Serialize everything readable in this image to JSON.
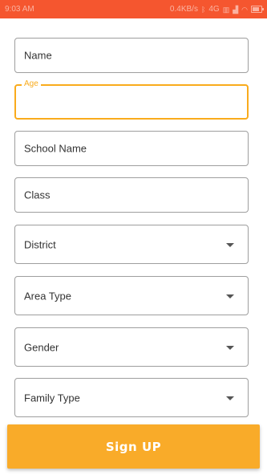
{
  "status_bar": {
    "time": "9:03 AM",
    "network_speed": "0.4KB/s",
    "network_type": "4G",
    "battery_fraction": 0.8,
    "icons": [
      "bluetooth-icon",
      "sim-icon",
      "signal-icon",
      "wifi-icon",
      "battery-icon"
    ]
  },
  "form": {
    "fields": [
      {
        "label": "Name",
        "type": "text"
      },
      {
        "label": "Age",
        "type": "text",
        "state": "focused"
      },
      {
        "label": "School Name",
        "type": "text"
      },
      {
        "label": "Class",
        "type": "text"
      }
    ],
    "dropdowns": [
      {
        "label": "District"
      },
      {
        "label": "Area Type"
      },
      {
        "label": "Gender"
      },
      {
        "label": "Family Type"
      }
    ],
    "submit_label": "Sign UP"
  },
  "colors": {
    "status_bar": "#f5562f",
    "accent": "#f9ab1c",
    "button": "#f9ab29",
    "border": "#9e9e9e"
  }
}
